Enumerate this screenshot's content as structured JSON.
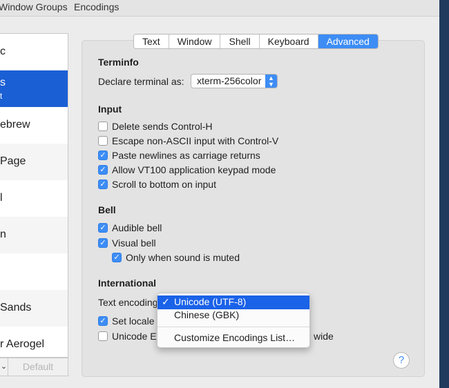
{
  "menubar": {
    "items": [
      "Window Groups",
      "Encodings"
    ]
  },
  "profiles": {
    "items": [
      {
        "name": "c",
        "sub": ""
      },
      {
        "name": "s",
        "sub": "t"
      },
      {
        "name": "ebrew",
        "sub": ""
      },
      {
        "name": "Page",
        "sub": ""
      },
      {
        "name": "l",
        "sub": ""
      },
      {
        "name": "n",
        "sub": ""
      },
      {
        "name": "",
        "sub": ""
      },
      {
        "name": "Sands",
        "sub": ""
      },
      {
        "name": "r Aerogel",
        "sub": ""
      }
    ],
    "selected_index": 1,
    "stepper_label": "⌄",
    "default_label": "Default"
  },
  "tabs": [
    {
      "label": "Text",
      "active": false
    },
    {
      "label": "Window",
      "active": false
    },
    {
      "label": "Shell",
      "active": false
    },
    {
      "label": "Keyboard",
      "active": false
    },
    {
      "label": "Advanced",
      "active": true
    }
  ],
  "terminfo": {
    "title": "Terminfo",
    "declare_label": "Declare terminal as:",
    "declare_value": "xterm-256color"
  },
  "input": {
    "title": "Input",
    "options": [
      {
        "label": "Delete sends Control-H",
        "checked": false
      },
      {
        "label": "Escape non-ASCII input with Control-V",
        "checked": false
      },
      {
        "label": "Paste newlines as carriage returns",
        "checked": true
      },
      {
        "label": "Allow VT100 application keypad mode",
        "checked": true
      },
      {
        "label": "Scroll to bottom on input",
        "checked": true
      }
    ]
  },
  "bell": {
    "title": "Bell",
    "options": [
      {
        "label": "Audible bell",
        "checked": true
      },
      {
        "label": "Visual bell",
        "checked": true
      },
      {
        "label": "Only when sound is muted",
        "checked": true
      }
    ]
  },
  "international": {
    "title": "International",
    "encoding_label": "Text encoding",
    "options": [
      {
        "label": "Set locale",
        "checked": true
      },
      {
        "label": "Unicode E",
        "checked": false
      }
    ],
    "trailing_text": "wide"
  },
  "encoding_menu": {
    "items": [
      {
        "label": "Unicode (UTF-8)",
        "selected": true,
        "check": "✓"
      },
      {
        "label": "Chinese (GBK)",
        "selected": false,
        "check": ""
      },
      {
        "label": "Customize Encodings List…",
        "selected": false,
        "check": ""
      }
    ]
  },
  "help": {
    "label": "?"
  },
  "colors": {
    "accent": "#3d8df5",
    "selection": "#1a5fd4",
    "menu_highlight": "#1a62e8"
  }
}
